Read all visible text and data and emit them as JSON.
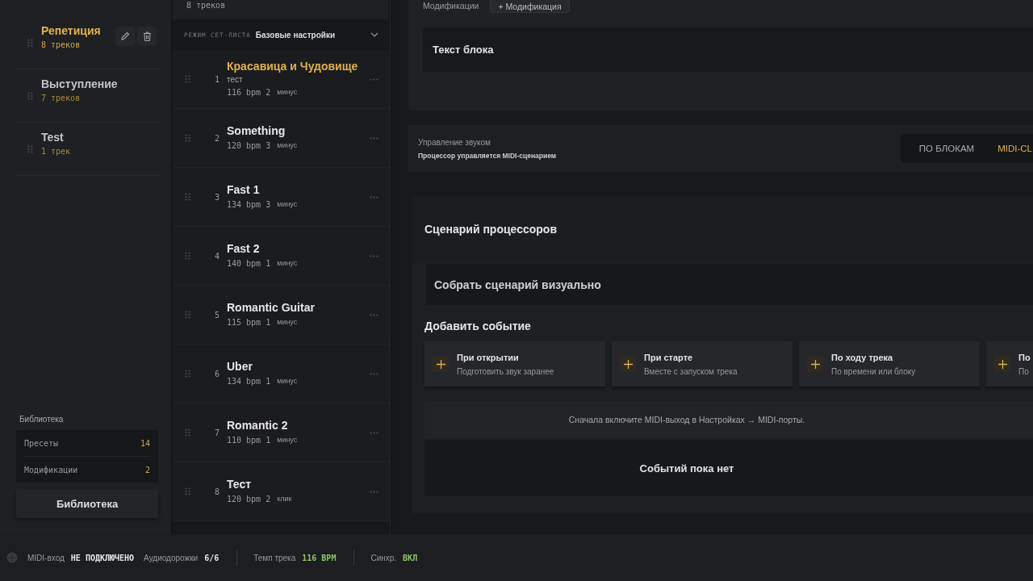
{
  "sidebar": {
    "setlists": [
      {
        "title": "Репетиция",
        "count": "8 треков",
        "selected": true
      },
      {
        "title": "Выступление",
        "count": "7 треков",
        "selected": false
      },
      {
        "title": "Test",
        "count": "1 трек",
        "selected": false
      }
    ],
    "library": {
      "title": "Библиотека",
      "items": [
        {
          "label": "Пресеты",
          "count": "14"
        },
        {
          "label": "Модификации",
          "count": "2"
        }
      ],
      "button": "Библиотека"
    }
  },
  "tracklist": {
    "count": "8 треков",
    "mode_label": "РЕЖИМ СЕТ-ЛИСТА",
    "mode_value": "Базовые настройки",
    "tracks": [
      {
        "number": "1",
        "title": "Красавица и Чудовище",
        "note": "тест",
        "bpm": "116 bpm",
        "count": "2",
        "type": "минус",
        "selected": true
      },
      {
        "number": "2",
        "title": "Something",
        "bpm": "120 bpm",
        "count": "3",
        "type": "минус",
        "selected": false
      },
      {
        "number": "3",
        "title": "Fast 1",
        "bpm": "134 bpm",
        "count": "3",
        "type": "минус",
        "selected": false
      },
      {
        "number": "4",
        "title": "Fast 2",
        "bpm": "140 bpm",
        "count": "1",
        "type": "минус",
        "selected": false
      },
      {
        "number": "5",
        "title": "Romantic Guitar",
        "bpm": "115 bpm",
        "count": "1",
        "type": "минус",
        "selected": false
      },
      {
        "number": "6",
        "title": "Uber",
        "bpm": "134 bpm",
        "count": "1",
        "type": "минус",
        "selected": false
      },
      {
        "number": "7",
        "title": "Romantic 2",
        "bpm": "110 bpm",
        "count": "1",
        "type": "минус",
        "selected": false
      },
      {
        "number": "8",
        "title": "Тест",
        "bpm": "120 bpm",
        "count": "2",
        "type": "клик",
        "selected": false
      }
    ]
  },
  "main": {
    "modifications": {
      "label": "Модификации",
      "add_button": "+ Модификация",
      "block_text": "Текст блока"
    },
    "sound_control": {
      "title": "Управление звуком",
      "subtitle": "Процессор управляется MIDI-сценарием",
      "modes": [
        {
          "label": "ПО БЛОКАМ",
          "selected": false
        },
        {
          "label": "MIDI-CL",
          "selected": true
        }
      ]
    },
    "scenario": {
      "title": "Сценарий процессоров",
      "visual_builder": "Собрать сценарий визуально",
      "add_event_title": "Добавить событие",
      "events": [
        {
          "title": "При открытии",
          "subtitle": "Подготовить звук заранее"
        },
        {
          "title": "При старте",
          "subtitle": "Вместе с запуском трека"
        },
        {
          "title": "По ходу трека",
          "subtitle": "По времени или блоку"
        },
        {
          "title": "По",
          "subtitle": "По"
        }
      ],
      "notice": "Сначала включите MIDI-выход в Настройках → MIDI-порты.",
      "empty": "Событий пока нет"
    }
  },
  "status_bar": {
    "groups": [
      {
        "items": [
          {
            "label": "MIDI-вход",
            "value": "НЕ ПОДКЛЮЧЕНО",
            "color": "#e2e2e2"
          },
          {
            "label": "Аудиодорожки",
            "value": "6/6",
            "color": "#e2e2e2"
          }
        ]
      },
      {
        "items": [
          {
            "label": "Темп трека",
            "value": "116 BPM",
            "color": "#8fc46a"
          }
        ]
      },
      {
        "items": [
          {
            "label": "Синхр.",
            "value": "ВКЛ",
            "color": "#8fc46a"
          }
        ]
      }
    ]
  }
}
